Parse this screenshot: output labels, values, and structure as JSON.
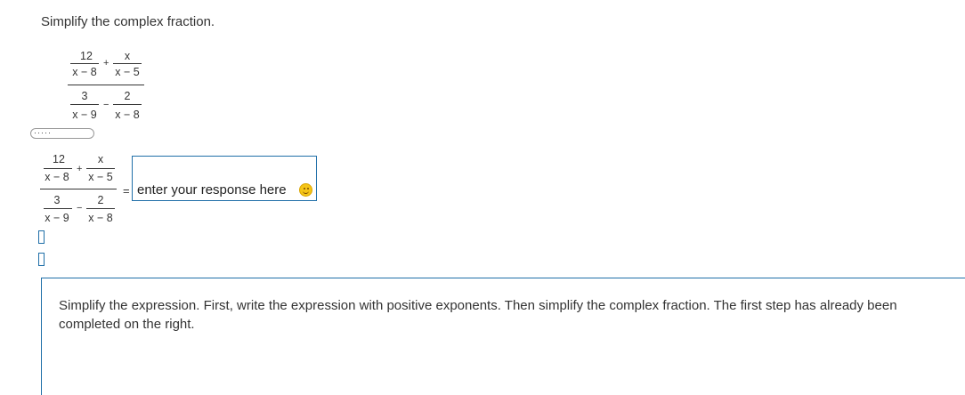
{
  "instruction": "Simplify the complex fraction.",
  "problem": {
    "num_left_top": "12",
    "num_left_bottom": "x − 8",
    "num_op": "+",
    "num_right_top": "x",
    "num_right_bottom": "x − 5",
    "den_left_top": "3",
    "den_left_bottom": "x − 9",
    "den_op": "−",
    "den_right_top": "2",
    "den_right_bottom": "x − 8"
  },
  "collapse_toggle": "·····",
  "work": {
    "num_left_top": "12",
    "num_left_bottom": "x − 8",
    "num_op": "+",
    "num_right_top": "x",
    "num_right_bottom": "x − 5",
    "den_left_top": "3",
    "den_left_bottom": "x − 9",
    "den_op": "−",
    "den_right_top": "2",
    "den_right_bottom": "x − 8",
    "equals": "=",
    "answer_placeholder": "enter your response here",
    "answer_icon": "smiley-icon"
  },
  "help": {
    "text": "Simplify the expression. First, write the expression with positive exponents. Then simplify the complex fraction. The first step has already been completed on the right."
  }
}
